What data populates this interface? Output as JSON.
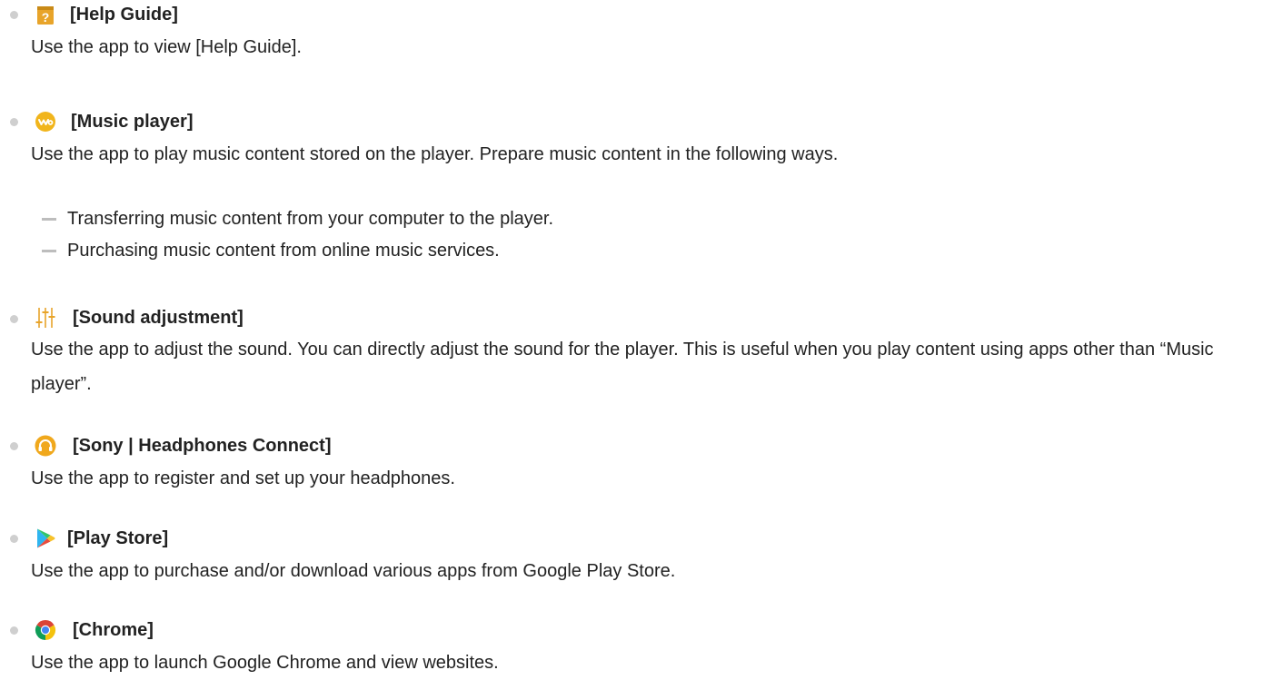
{
  "items": [
    {
      "icon": "help-guide-icon",
      "title": "[Help Guide]",
      "description": "Use the app to view [Help Guide]."
    },
    {
      "icon": "music-player-icon",
      "title": "[Music player]",
      "description": "Use the app to play music content stored on the player. Prepare music content in the following ways.",
      "subitems": [
        "Transferring music content from your computer to the player.",
        "Purchasing music content from online music services."
      ]
    },
    {
      "icon": "sound-adjustment-icon",
      "title": "[Sound adjustment]",
      "description": "Use the app to adjust the sound. You can directly adjust the sound for the player. This is useful when you play content using apps other than “Music player”."
    },
    {
      "icon": "headphones-connect-icon",
      "title": "[Sony | Headphones Connect]",
      "description": "Use the app to register and set up your headphones."
    },
    {
      "icon": "play-store-icon",
      "title": "[Play Store]",
      "description": "Use the app to purchase and/or download various apps from Google Play Store."
    },
    {
      "icon": "chrome-icon",
      "title": "[Chrome]",
      "description": "Use the app to launch Google Chrome and view websites."
    }
  ],
  "colors": {
    "text": "#222222",
    "bullet": "#cfcfcf",
    "dash": "#bdbdbd",
    "help_icon": "#e8a42a",
    "music_icon": "#f1b51c",
    "sound_icon": "#e8a42a",
    "headphones_icon": "#f0a81c"
  }
}
